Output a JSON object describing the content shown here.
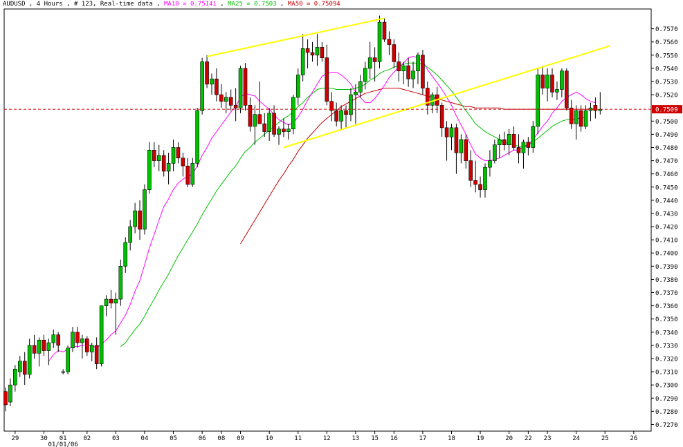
{
  "header": {
    "symbol_info": "AUDUSD , 4 Hours , # 123, Real-time data",
    "sep": " , ",
    "ma10_label": "MA10 = 0.75141",
    "ma25_label": "MA25 = 0.7503",
    "ma50_label": "MA50 = 0.75094"
  },
  "colors": {
    "background": "#ffffff",
    "up_candle": "#00c000",
    "down_candle": "#d00000",
    "wick": "#000000",
    "ma10": "#ff00ff",
    "ma25": "#00c000",
    "ma50": "#c00000",
    "trendline": "#ffff00",
    "current_price_line": "#d00000",
    "price_tag_bg": "#d00000"
  },
  "chart_data": {
    "type": "candlestick",
    "symbol": "AUDUSD",
    "timeframe": "4 Hours",
    "current_price": 0.7509,
    "current_price_label": "0.7509",
    "ylim": [
      0.7265,
      0.7585
    ],
    "y_ticks": [
      "0.7570",
      "0.7560",
      "0.7550",
      "0.7540",
      "0.7530",
      "0.7520",
      "0.7510",
      "0.7500",
      "0.7490",
      "0.7480",
      "0.7470",
      "0.7460",
      "0.7450",
      "0.7440",
      "0.7430",
      "0.7420",
      "0.7410",
      "0.7400",
      "0.7390",
      "0.7380",
      "0.7370",
      "0.7360",
      "0.7350",
      "0.7340",
      "0.7330",
      "0.7320",
      "0.7310",
      "0.7300",
      "0.7290",
      "0.7280",
      "0.7270"
    ],
    "x_ticks": [
      "29",
      "30",
      "01",
      "02",
      "03",
      "04",
      "05",
      "06",
      "08",
      "09",
      "10",
      "11",
      "12",
      "13",
      "15",
      "16",
      "17",
      "18",
      "19",
      "20",
      "22",
      "23",
      "24",
      "25",
      "26"
    ],
    "x_tick_bar_index": [
      2,
      8,
      12,
      17,
      23,
      29,
      35,
      41,
      45,
      49,
      55,
      61,
      67,
      73,
      77,
      81,
      87,
      93,
      99,
      105,
      109,
      113,
      119,
      125,
      131
    ],
    "date_marker": "01/01/06",
    "candles": [
      [
        0.7295,
        0.7298,
        0.728,
        0.7285
      ],
      [
        0.7287,
        0.7305,
        0.7284,
        0.73
      ],
      [
        0.73,
        0.7315,
        0.7295,
        0.7312
      ],
      [
        0.731,
        0.7322,
        0.7306,
        0.7318
      ],
      [
        0.7318,
        0.7325,
        0.73,
        0.7308
      ],
      [
        0.7308,
        0.7335,
        0.7305,
        0.733
      ],
      [
        0.733,
        0.7338,
        0.732,
        0.7324
      ],
      [
        0.7324,
        0.7336,
        0.7314,
        0.7334
      ],
      [
        0.7334,
        0.7338,
        0.7322,
        0.7326
      ],
      [
        0.7326,
        0.7335,
        0.7315,
        0.7332
      ],
      [
        0.7332,
        0.7342,
        0.7328,
        0.7338
      ],
      [
        0.7338,
        0.734,
        0.7325,
        0.733
      ],
      [
        0.731,
        0.7312,
        0.7308,
        0.731
      ],
      [
        0.731,
        0.733,
        0.7308,
        0.7328
      ],
      [
        0.7328,
        0.7344,
        0.7325,
        0.734
      ],
      [
        0.734,
        0.7344,
        0.7328,
        0.7332
      ],
      [
        0.7332,
        0.7338,
        0.732,
        0.7335
      ],
      [
        0.7335,
        0.7337,
        0.7322,
        0.7325
      ],
      [
        0.7325,
        0.7332,
        0.7318,
        0.733
      ],
      [
        0.733,
        0.7336,
        0.7312,
        0.7316
      ],
      [
        0.7316,
        0.7345,
        0.7314,
        0.736
      ],
      [
        0.736,
        0.7368,
        0.7352,
        0.7365
      ],
      [
        0.7365,
        0.7372,
        0.7358,
        0.7362
      ],
      [
        0.7362,
        0.737,
        0.7338,
        0.7365
      ],
      [
        0.7365,
        0.7395,
        0.736,
        0.739
      ],
      [
        0.739,
        0.7412,
        0.7385,
        0.7408
      ],
      [
        0.7408,
        0.7425,
        0.7402,
        0.742
      ],
      [
        0.742,
        0.7438,
        0.7415,
        0.7432
      ],
      [
        0.7432,
        0.744,
        0.741,
        0.7418
      ],
      [
        0.7418,
        0.7452,
        0.7414,
        0.7448
      ],
      [
        0.7448,
        0.7484,
        0.7445,
        0.7478
      ],
      [
        0.7478,
        0.7484,
        0.7465,
        0.747
      ],
      [
        0.747,
        0.7482,
        0.7462,
        0.7474
      ],
      [
        0.7474,
        0.7478,
        0.7458,
        0.7462
      ],
      [
        0.7462,
        0.7476,
        0.7452,
        0.7468
      ],
      [
        0.7468,
        0.7486,
        0.7462,
        0.748
      ],
      [
        0.748,
        0.7484,
        0.7468,
        0.7472
      ],
      [
        0.7472,
        0.7476,
        0.7458,
        0.7466
      ],
      [
        0.7466,
        0.7472,
        0.745,
        0.7452
      ],
      [
        0.7452,
        0.7472,
        0.745,
        0.7468
      ],
      [
        0.7468,
        0.751,
        0.7465,
        0.7508
      ],
      [
        0.7508,
        0.7548,
        0.7505,
        0.7545
      ],
      [
        0.7545,
        0.755,
        0.7525,
        0.7528
      ],
      [
        0.7528,
        0.7536,
        0.752,
        0.7532
      ],
      [
        0.7532,
        0.754,
        0.7515,
        0.752
      ],
      [
        0.752,
        0.7528,
        0.751,
        0.7515
      ],
      [
        0.7515,
        0.7522,
        0.7506,
        0.7518
      ],
      [
        0.7518,
        0.7524,
        0.7508,
        0.7512
      ],
      [
        0.7512,
        0.7525,
        0.75,
        0.751
      ],
      [
        0.751,
        0.7542,
        0.7506,
        0.754
      ],
      [
        0.754,
        0.7544,
        0.7508,
        0.7512
      ],
      [
        0.7512,
        0.7518,
        0.7492,
        0.7496
      ],
      [
        0.7496,
        0.7512,
        0.7482,
        0.7505
      ],
      [
        0.7505,
        0.753,
        0.75,
        0.7498
      ],
      [
        0.7498,
        0.7506,
        0.7488,
        0.7492
      ],
      [
        0.7492,
        0.751,
        0.7485,
        0.7506
      ],
      [
        0.7506,
        0.7512,
        0.7488,
        0.749
      ],
      [
        0.749,
        0.7496,
        0.7482,
        0.7494
      ],
      [
        0.7494,
        0.7502,
        0.7488,
        0.7492
      ],
      [
        0.7492,
        0.7498,
        0.7486,
        0.7494
      ],
      [
        0.7494,
        0.752,
        0.749,
        0.7518
      ],
      [
        0.7518,
        0.754,
        0.7512,
        0.7535
      ],
      [
        0.7535,
        0.7566,
        0.753,
        0.7555
      ],
      [
        0.7555,
        0.7562,
        0.754,
        0.7552
      ],
      [
        0.7552,
        0.756,
        0.7545,
        0.755
      ],
      [
        0.755,
        0.7566,
        0.7542,
        0.7556
      ],
      [
        0.7556,
        0.756,
        0.7545,
        0.7548
      ],
      [
        0.7548,
        0.7558,
        0.7512,
        0.7515
      ],
      [
        0.7515,
        0.7522,
        0.75,
        0.7508
      ],
      [
        0.7508,
        0.7514,
        0.7496,
        0.75
      ],
      [
        0.75,
        0.7512,
        0.7494,
        0.7508
      ],
      [
        0.7508,
        0.7512,
        0.7495,
        0.7505
      ],
      [
        0.7505,
        0.7525,
        0.75,
        0.752
      ],
      [
        0.752,
        0.7528,
        0.7498,
        0.7522
      ],
      [
        0.7522,
        0.7535,
        0.7518,
        0.753
      ],
      [
        0.753,
        0.7545,
        0.7524,
        0.754
      ],
      [
        0.754,
        0.756,
        0.7532,
        0.7548
      ],
      [
        0.7548,
        0.7556,
        0.753,
        0.7545
      ],
      [
        0.7545,
        0.758,
        0.754,
        0.7575
      ],
      [
        0.7575,
        0.7578,
        0.756,
        0.7562
      ],
      [
        0.7562,
        0.7568,
        0.755,
        0.7558
      ],
      [
        0.7558,
        0.7562,
        0.754,
        0.7545
      ],
      [
        0.7545,
        0.7552,
        0.753,
        0.7538
      ],
      [
        0.7538,
        0.7545,
        0.7528,
        0.7542
      ],
      [
        0.7542,
        0.7548,
        0.7526,
        0.7532
      ],
      [
        0.7532,
        0.7545,
        0.7525,
        0.7538
      ],
      [
        0.7538,
        0.7552,
        0.7528,
        0.755
      ],
      [
        0.755,
        0.7554,
        0.752,
        0.7525
      ],
      [
        0.7525,
        0.753,
        0.7505,
        0.7512
      ],
      [
        0.7512,
        0.7522,
        0.7506,
        0.752
      ],
      [
        0.752,
        0.7526,
        0.7506,
        0.7512
      ],
      [
        0.7512,
        0.7514,
        0.7488,
        0.7495
      ],
      [
        0.7495,
        0.75,
        0.747,
        0.7488
      ],
      [
        0.7488,
        0.7498,
        0.7478,
        0.7495
      ],
      [
        0.7495,
        0.7498,
        0.746,
        0.7476
      ],
      [
        0.7476,
        0.749,
        0.7468,
        0.7486
      ],
      [
        0.7486,
        0.749,
        0.7464,
        0.747
      ],
      [
        0.747,
        0.7478,
        0.745,
        0.7455
      ],
      [
        0.7455,
        0.747,
        0.7446,
        0.7452
      ],
      [
        0.7452,
        0.7458,
        0.7442,
        0.7448
      ],
      [
        0.7448,
        0.7468,
        0.7442,
        0.7465
      ],
      [
        0.7465,
        0.7478,
        0.7458,
        0.747
      ],
      [
        0.747,
        0.7486,
        0.7468,
        0.7482
      ],
      [
        0.7482,
        0.749,
        0.7472,
        0.7486
      ],
      [
        0.7486,
        0.7492,
        0.7478,
        0.7482
      ],
      [
        0.7482,
        0.7494,
        0.7474,
        0.749
      ],
      [
        0.749,
        0.7496,
        0.7478,
        0.748
      ],
      [
        0.748,
        0.749,
        0.7468,
        0.7476
      ],
      [
        0.7476,
        0.7486,
        0.7464,
        0.7484
      ],
      [
        0.7484,
        0.7488,
        0.7474,
        0.748
      ],
      [
        0.748,
        0.75,
        0.7476,
        0.7496
      ],
      [
        0.7496,
        0.754,
        0.749,
        0.7535
      ],
      [
        0.7535,
        0.7542,
        0.752,
        0.7525
      ],
      [
        0.7525,
        0.754,
        0.7515,
        0.7535
      ],
      [
        0.7535,
        0.754,
        0.7518,
        0.7522
      ],
      [
        0.7522,
        0.753,
        0.7516,
        0.7524
      ],
      [
        0.7524,
        0.754,
        0.7518,
        0.7538
      ],
      [
        0.7538,
        0.754,
        0.7508,
        0.751
      ],
      [
        0.751,
        0.7516,
        0.7494,
        0.7498
      ],
      [
        0.7498,
        0.7512,
        0.7486,
        0.7508
      ],
      [
        0.7508,
        0.7512,
        0.7492,
        0.7496
      ],
      [
        0.7496,
        0.7512,
        0.7494,
        0.7508
      ],
      [
        0.7508,
        0.7514,
        0.75,
        0.751
      ],
      [
        0.7512,
        0.7518,
        0.7502,
        0.7508
      ],
      [
        0.7508,
        0.7522,
        0.7505,
        0.7509
      ]
    ],
    "ma10": [
      null,
      null,
      null,
      null,
      null,
      null,
      null,
      null,
      null,
      0.7318,
      0.7323,
      0.7326,
      0.7325,
      0.7327,
      0.7329,
      0.7329,
      0.733,
      0.733,
      0.733,
      0.7328,
      0.7331,
      0.7334,
      0.7338,
      0.7341,
      0.7347,
      0.7353,
      0.7361,
      0.7371,
      0.7379,
      0.7391,
      0.7404,
      0.7414,
      0.7425,
      0.7435,
      0.7441,
      0.7448,
      0.7453,
      0.7456,
      0.7458,
      0.746,
      0.7466,
      0.7474,
      0.748,
      0.7487,
      0.7492,
      0.7497,
      0.7502,
      0.7507,
      0.7511,
      0.7518,
      0.7521,
      0.752,
      0.7519,
      0.7515,
      0.7512,
      0.7509,
      0.7505,
      0.7501,
      0.7499,
      0.7497,
      0.7499,
      0.7503,
      0.7509,
      0.7516,
      0.7522,
      0.7528,
      0.7534,
      0.7536,
      0.7537,
      0.7537,
      0.7535,
      0.7532,
      0.7528,
      0.7522,
      0.7518,
      0.7514,
      0.7514,
      0.7517,
      0.7522,
      0.7527,
      0.7533,
      0.7537,
      0.7541,
      0.7544,
      0.7548,
      0.7549,
      0.7548,
      0.7545,
      0.7539,
      0.7534,
      0.7529,
      0.7524,
      0.7518,
      0.7512,
      0.7504,
      0.7497,
      0.749,
      0.7482,
      0.7475,
      0.7472,
      0.747,
      0.747,
      0.7471,
      0.7472,
      0.7474,
      0.7476,
      0.7478,
      0.7478,
      0.748,
      0.7482,
      0.7486,
      0.7491,
      0.7496,
      0.75,
      0.7506,
      0.751,
      0.7515,
      0.7518,
      0.752,
      0.7522,
      0.752,
      0.7517,
      0.7515,
      0.7514
    ],
    "ma25": [
      null,
      null,
      null,
      null,
      null,
      null,
      null,
      null,
      null,
      null,
      null,
      null,
      null,
      null,
      null,
      null,
      null,
      null,
      null,
      null,
      null,
      null,
      null,
      null,
      0.7329,
      0.7332,
      0.7337,
      0.7342,
      0.7346,
      0.7352,
      0.7359,
      0.7365,
      0.7372,
      0.7378,
      0.7384,
      0.7391,
      0.7398,
      0.7404,
      0.741,
      0.7416,
      0.7422,
      0.7429,
      0.7435,
      0.7441,
      0.7447,
      0.7452,
      0.7457,
      0.7462,
      0.7466,
      0.7472,
      0.7477,
      0.748,
      0.7484,
      0.7487,
      0.749,
      0.7493,
      0.7496,
      0.7499,
      0.7502,
      0.7504,
      0.7507,
      0.7511,
      0.7514,
      0.7518,
      0.7521,
      0.7524,
      0.7525,
      0.7525,
      0.7525,
      0.7524,
      0.7524,
      0.7524,
      0.7524,
      0.7525,
      0.7526,
      0.7528,
      0.7531,
      0.7533,
      0.7536,
      0.7538,
      0.7539,
      0.7541,
      0.7542,
      0.7543,
      0.7544,
      0.7544,
      0.7544,
      0.7543,
      0.7541,
      0.7538,
      0.7535,
      0.7531,
      0.7527,
      0.7523,
      0.7518,
      0.7513,
      0.7508,
      0.7503,
      0.7498,
      0.7495,
      0.7492,
      0.749,
      0.7488,
      0.7486,
      0.7484,
      0.7483,
      0.7482,
      0.7481,
      0.7481,
      0.7482,
      0.7484,
      0.7487,
      0.749,
      0.7493,
      0.7496,
      0.7498,
      0.75,
      0.7501,
      0.7501,
      0.7502,
      0.7502,
      0.7503
    ],
    "ma50": [
      null,
      null,
      null,
      null,
      null,
      null,
      null,
      null,
      null,
      null,
      null,
      null,
      null,
      null,
      null,
      null,
      null,
      null,
      null,
      null,
      null,
      null,
      null,
      null,
      null,
      null,
      null,
      null,
      null,
      null,
      null,
      null,
      null,
      null,
      null,
      null,
      null,
      null,
      null,
      null,
      null,
      null,
      null,
      null,
      null,
      null,
      null,
      null,
      null,
      0.7407,
      0.7413,
      0.7419,
      0.7425,
      0.7431,
      0.7437,
      0.7443,
      0.7449,
      0.7455,
      0.746,
      0.7466,
      0.7471,
      0.7477,
      0.7482,
      0.7487,
      0.7491,
      0.7495,
      0.7499,
      0.7502,
      0.7505,
      0.7508,
      0.7511,
      0.7513,
      0.7515,
      0.7517,
      0.7519,
      0.7521,
      0.7522,
      0.7523,
      0.7524,
      0.7525,
      0.7525,
      0.7525,
      0.7525,
      0.7524,
      0.7523,
      0.7522,
      0.7521,
      0.752,
      0.7519,
      0.7518,
      0.7517,
      0.7516,
      0.7515,
      0.7514,
      0.7513,
      0.7512,
      0.7511,
      0.7511,
      0.751,
      0.751,
      0.751,
      0.751,
      0.751,
      0.751,
      0.7509,
      0.7509,
      0.7509,
      0.7509,
      0.7509,
      0.7509,
      0.7509,
      0.7509,
      0.7509,
      0.7509,
      0.7509,
      0.7509,
      0.7509,
      0.7509,
      0.7509,
      0.7509,
      0.7509,
      0.7509,
      0.7509,
      0.7509
    ],
    "trendlines": [
      {
        "from": [
          42,
          0.7549
        ],
        "to": [
          79,
          0.7578
        ]
      },
      {
        "from": [
          58,
          0.748
        ],
        "to": [
          126,
          0.7557
        ]
      }
    ]
  }
}
